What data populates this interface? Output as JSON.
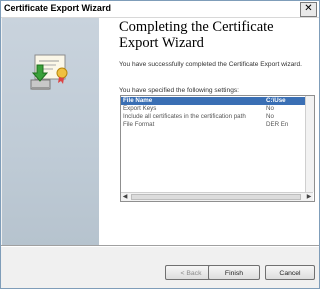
{
  "window": {
    "title": "Certificate Export Wizard",
    "close_glyph": "✕",
    "close_icon": "close-icon"
  },
  "page": {
    "heading": "Completing the Certificate Export Wizard",
    "completion_text": "You have successfully completed the Certificate Export wizard.",
    "settings_intro": "You have specified the following settings:"
  },
  "settings": {
    "header": {
      "key": "File Name",
      "value": "C:\\Use"
    },
    "rows": [
      {
        "key": "Export Keys",
        "value": "No"
      },
      {
        "key": "Include all certificates in the certification path",
        "value": "No"
      },
      {
        "key": "File Format",
        "value": "DER En"
      }
    ]
  },
  "scrollbars": {
    "left_arrow": "◀",
    "right_arrow": "▶"
  },
  "buttons": {
    "back": "< Back",
    "finish": "Finish",
    "cancel": "Cancel"
  }
}
